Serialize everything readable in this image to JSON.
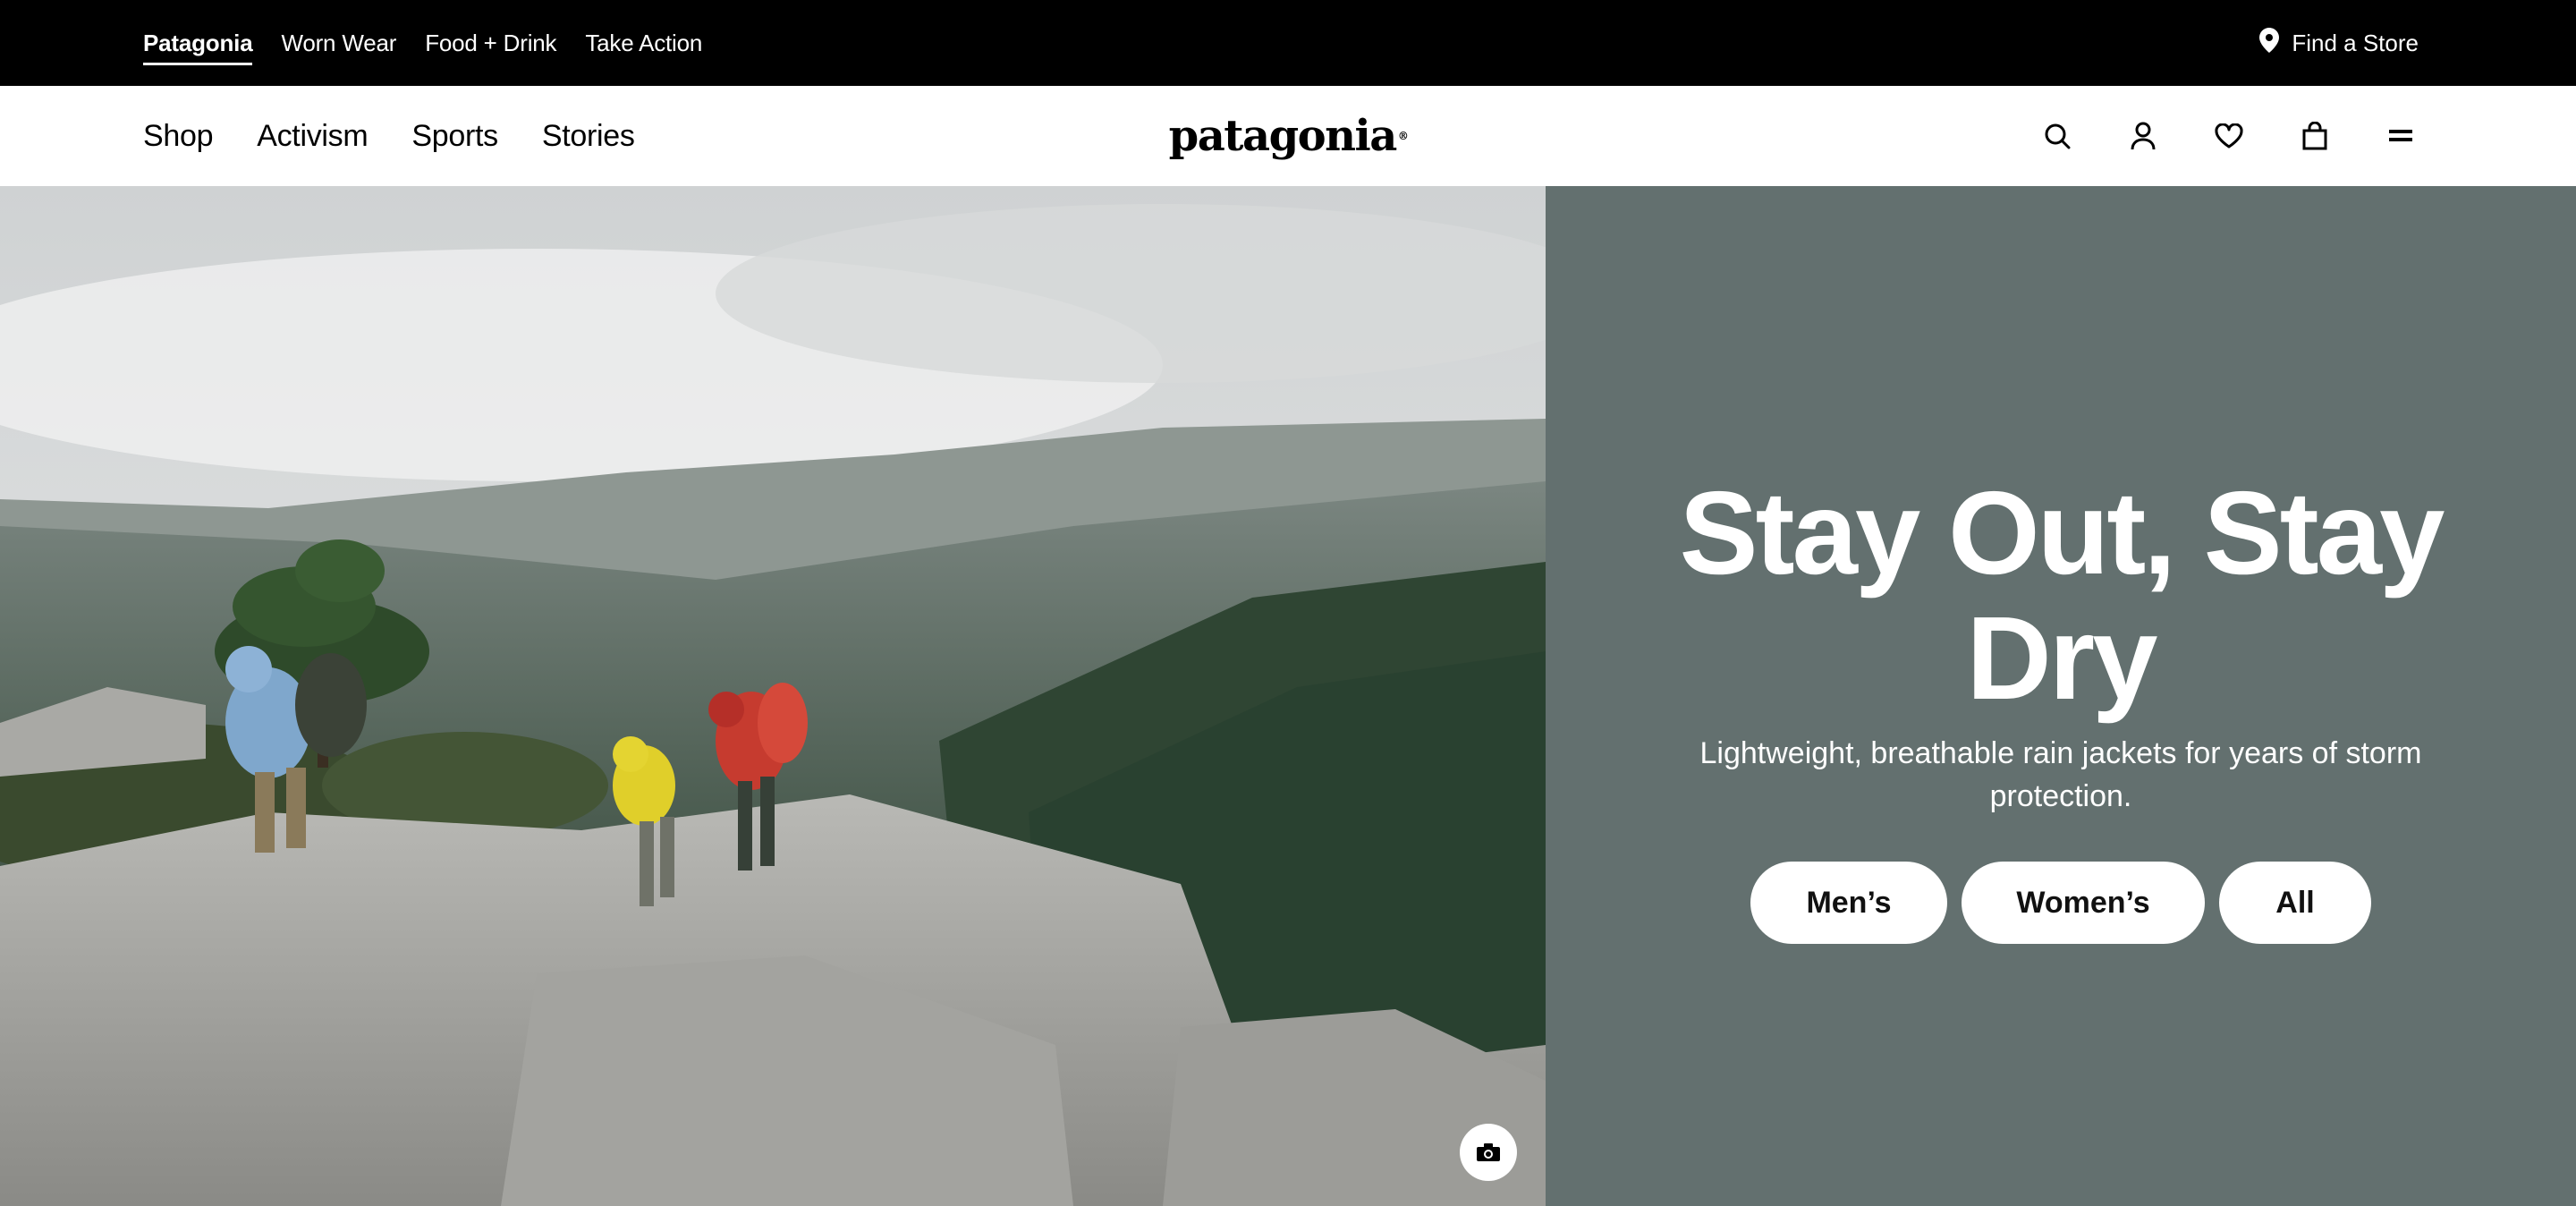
{
  "utility_bar": {
    "brands": [
      "Patagonia",
      "Worn Wear",
      "Food + Drink",
      "Take Action"
    ],
    "active_brand": "Patagonia",
    "find_store": "Find a Store",
    "find_store_icon": "map-pin-icon"
  },
  "nav": {
    "links": [
      "Shop",
      "Activism",
      "Sports",
      "Stories"
    ],
    "logo": "patagonia",
    "icons": [
      "search-icon",
      "account-icon",
      "heart-icon",
      "bag-icon",
      "menu-icon"
    ]
  },
  "hero": {
    "headline": "Stay Out, Stay Dry",
    "subtext": "Lightweight, breathable rain jackets for years of storm protection.",
    "buttons": [
      "Men’s",
      "Women’s",
      "All"
    ],
    "panel_color": "#63706f",
    "camera_icon": "camera-icon"
  }
}
